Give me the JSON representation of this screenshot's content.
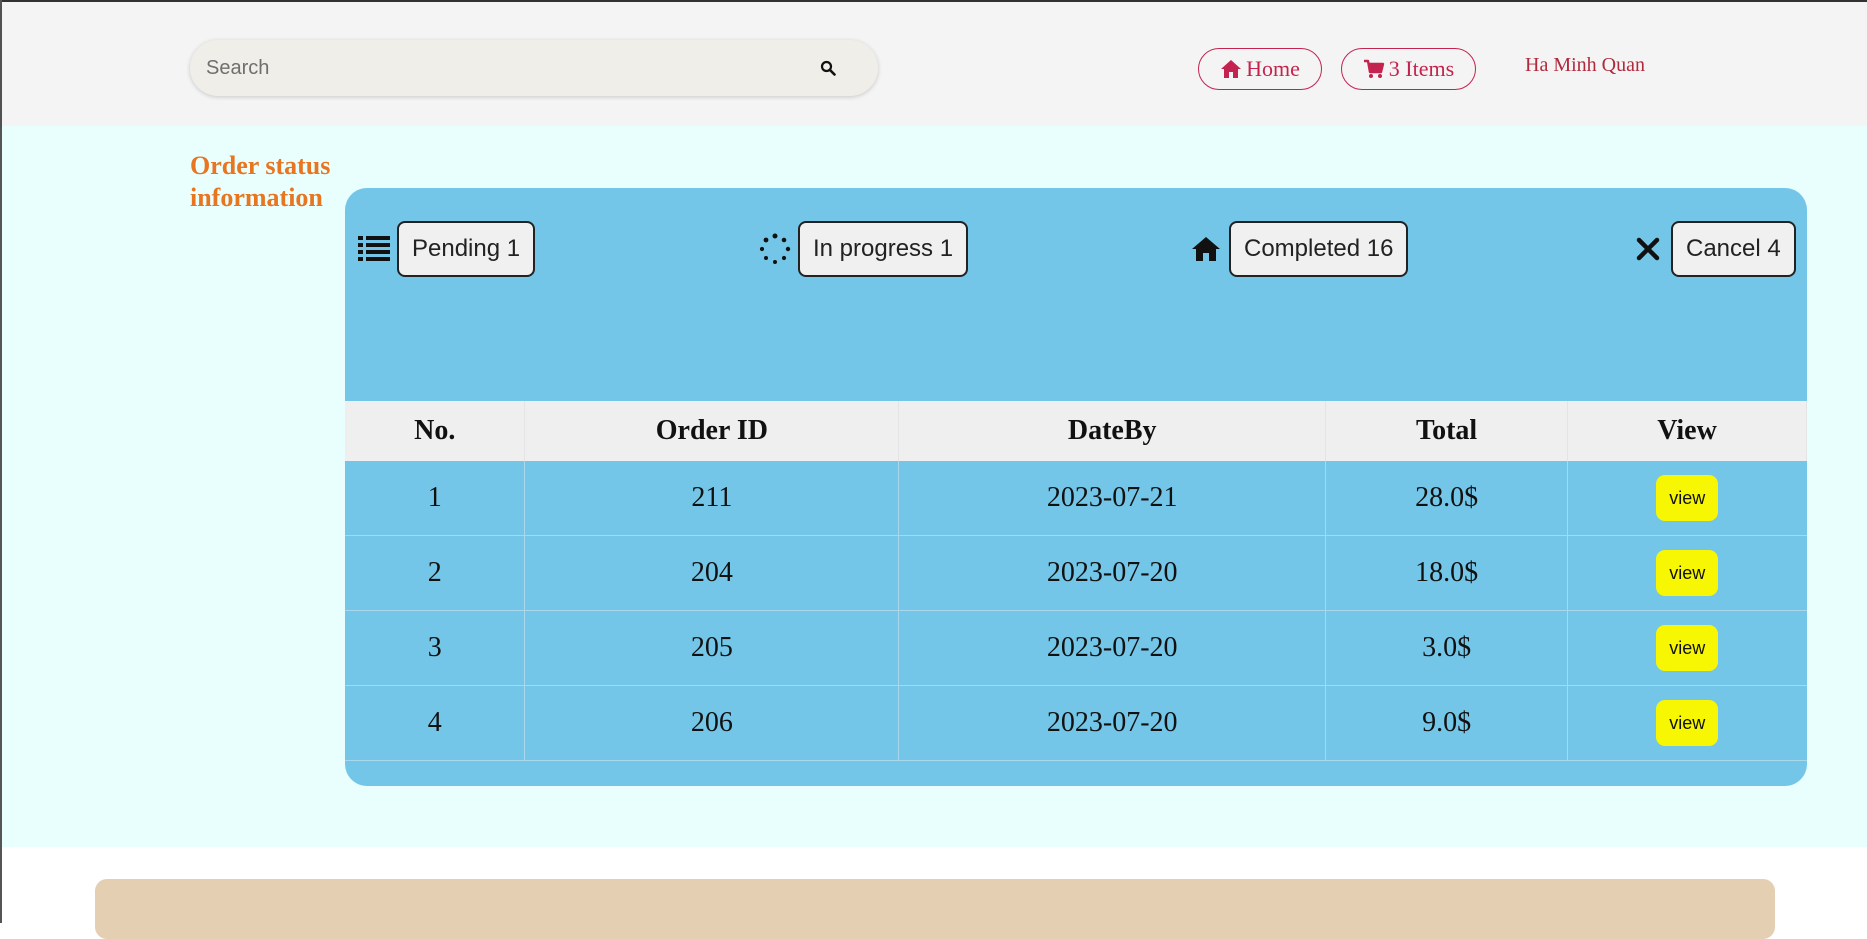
{
  "header": {
    "search": {
      "placeholder": "Search"
    },
    "nav": {
      "home_label": "Home",
      "cart_label": "3 Items"
    },
    "user_name": "Ha Minh Quan"
  },
  "main": {
    "section_title": "Order status information",
    "statuses": [
      {
        "icon": "list-icon",
        "label": "Pending 1"
      },
      {
        "icon": "spinner-icon",
        "label": "In progress 1"
      },
      {
        "icon": "home-icon",
        "label": "Completed 16"
      },
      {
        "icon": "close-icon",
        "label": "Cancel 4"
      }
    ],
    "table": {
      "headers": [
        "No.",
        "Order ID",
        "DateBy",
        "Total",
        "View"
      ],
      "rows": [
        {
          "no": "1",
          "order_id": "211",
          "date": "2023-07-21",
          "total": "28.0$",
          "view": "view"
        },
        {
          "no": "2",
          "order_id": "204",
          "date": "2023-07-20",
          "total": "18.0$",
          "view": "view"
        },
        {
          "no": "3",
          "order_id": "205",
          "date": "2023-07-20",
          "total": "3.0$",
          "view": "view"
        },
        {
          "no": "4",
          "order_id": "206",
          "date": "2023-07-20",
          "total": "9.0$",
          "view": "view"
        }
      ]
    }
  },
  "colors": {
    "accent": "#c4234f",
    "title": "#e8751f",
    "panel": "#73c6e8",
    "page_bg": "#e8fffd",
    "view_button": "#f7f704",
    "footer": "#e4cfb2"
  }
}
